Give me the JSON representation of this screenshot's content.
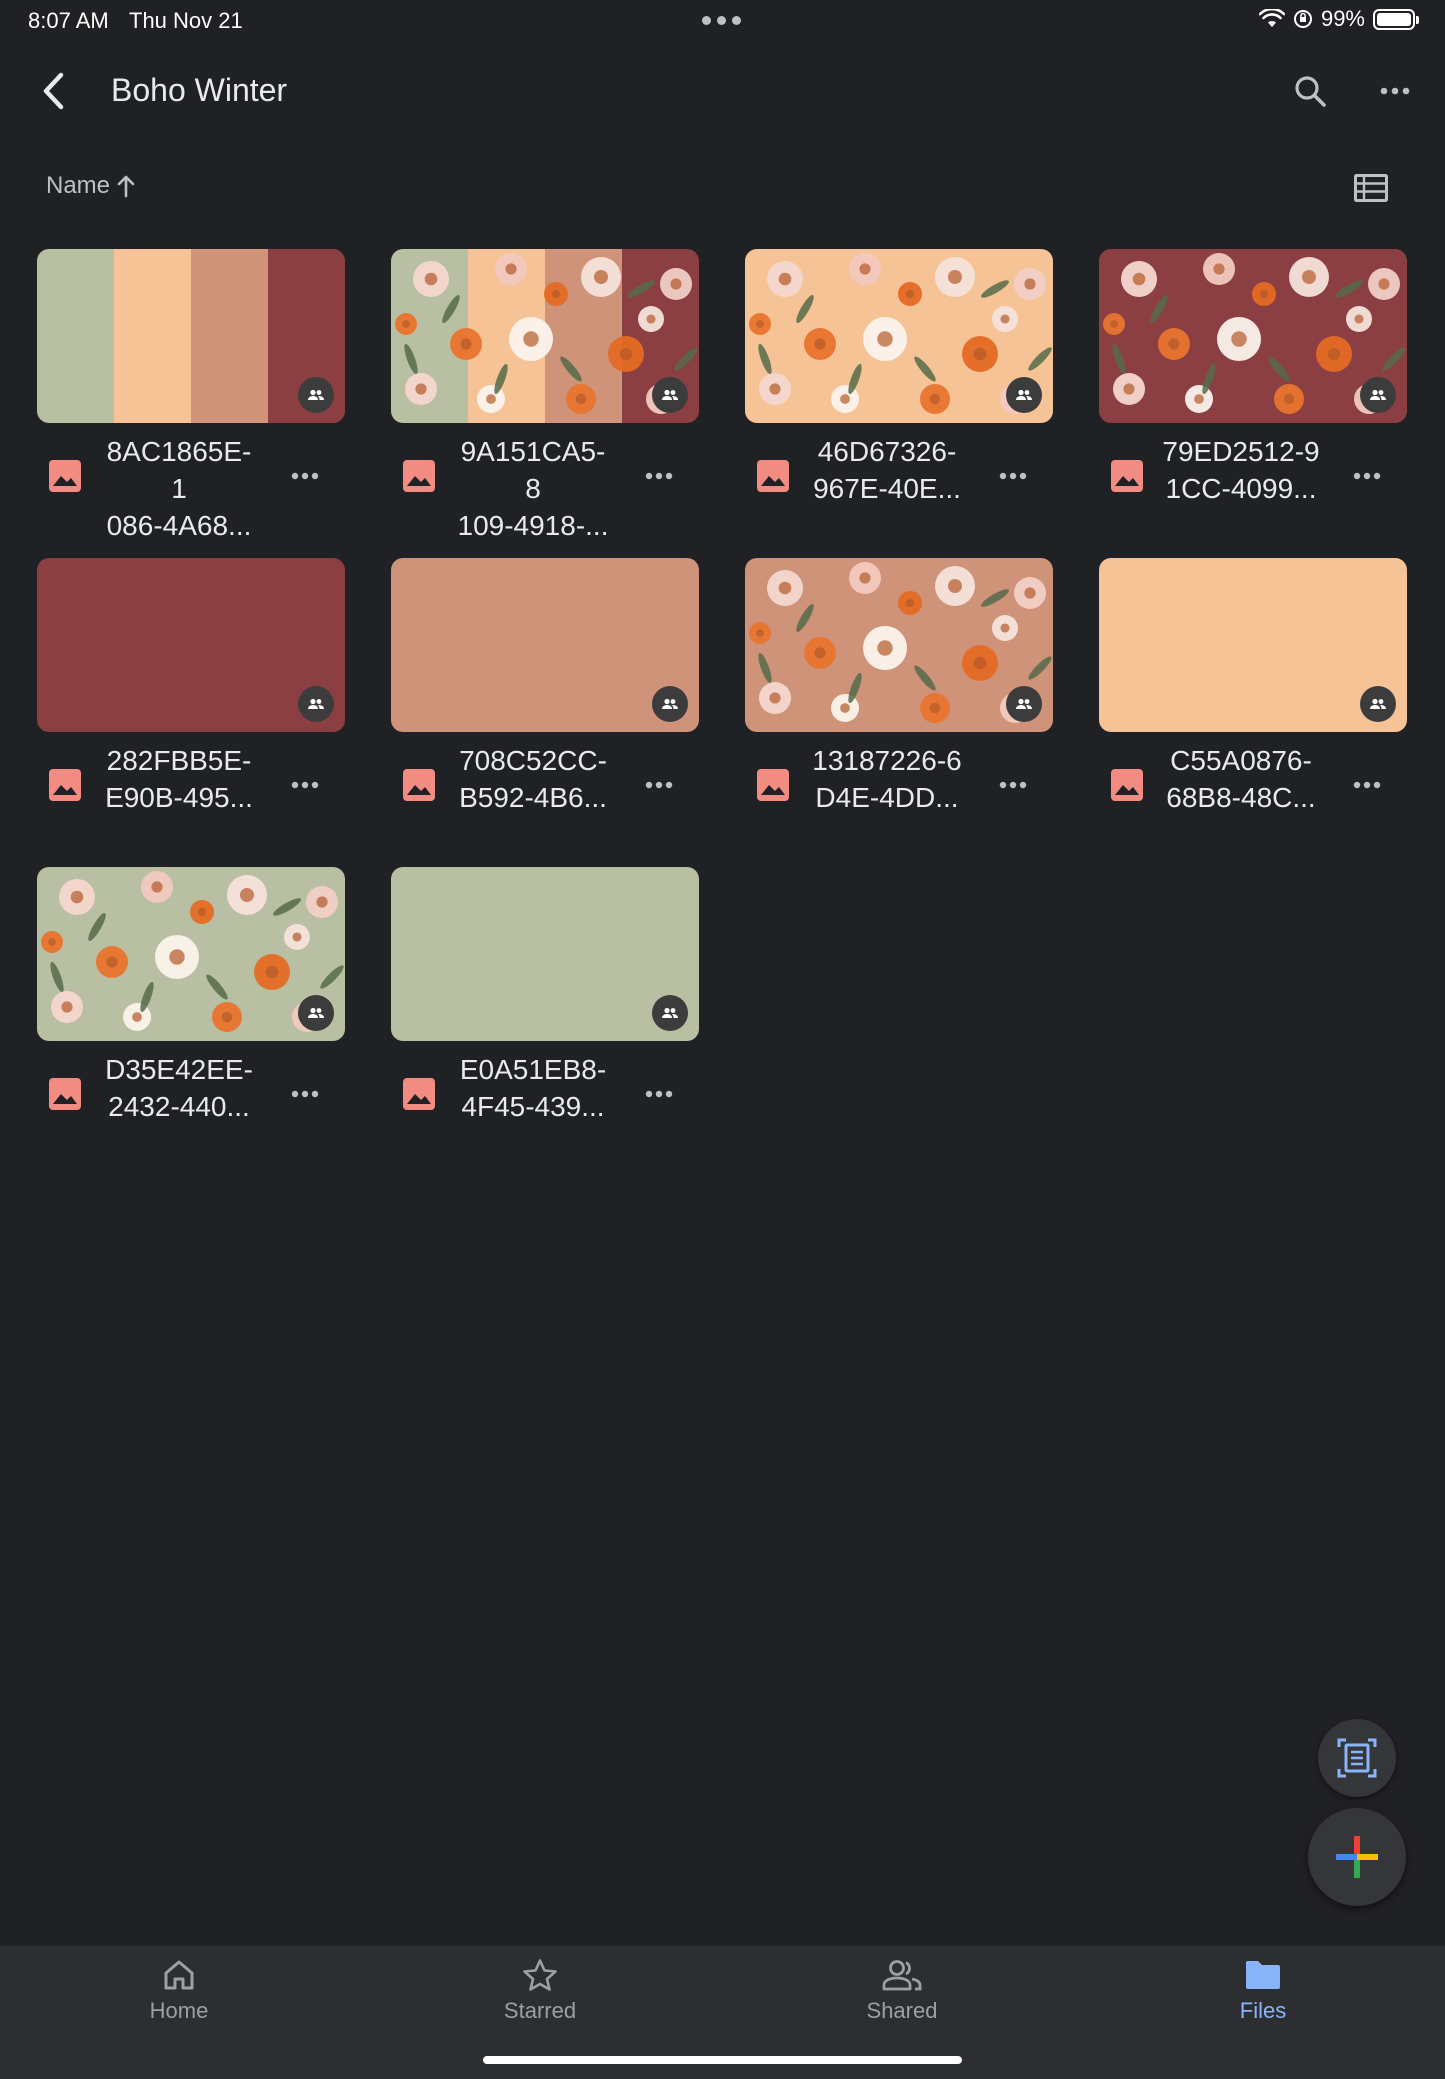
{
  "status_bar": {
    "time": "8:07 AM",
    "date": "Thu Nov 21",
    "battery": "99%"
  },
  "header": {
    "title": "Boho Winter",
    "back_icon": "chevron-left-icon",
    "search_icon": "search-icon",
    "more_icon": "more-horizontal-icon"
  },
  "sort": {
    "label": "Name",
    "direction": "ascending",
    "view_icon": "list-view-icon"
  },
  "files": [
    {
      "name_line1": "8AC1865E-1",
      "name_line2": "086-4A68...",
      "thumb": "palette",
      "shared": true
    },
    {
      "name_line1": "9A151CA5-8",
      "name_line2": "109-4918-...",
      "thumb": "floral-palette",
      "shared": true
    },
    {
      "name_line1": "46D67326-",
      "name_line2": "967E-40E...",
      "thumb": "floral-peach",
      "shared": true
    },
    {
      "name_line1": "79ED2512-9",
      "name_line2": "1CC-4099...",
      "thumb": "floral-maroon",
      "shared": true
    },
    {
      "name_line1": "282FBB5E-",
      "name_line2": "E90B-495...",
      "thumb": "solid-maroon",
      "shared": true
    },
    {
      "name_line1": "708C52CC-",
      "name_line2": "B592-4B6...",
      "thumb": "solid-terracotta",
      "shared": true
    },
    {
      "name_line1": "13187226-6",
      "name_line2": "D4E-4DD...",
      "thumb": "floral-terracotta",
      "shared": true
    },
    {
      "name_line1": "C55A0876-",
      "name_line2": "68B8-48C...",
      "thumb": "solid-peach",
      "shared": true
    },
    {
      "name_line1": "D35E42EE-",
      "name_line2": "2432-440...",
      "thumb": "floral-sage",
      "shared": true
    },
    {
      "name_line1": "E0A51EB8-",
      "name_line2": "4F45-439...",
      "thumb": "solid-sage",
      "shared": true
    }
  ],
  "colors": {
    "sage": "#b9bfa3",
    "peach": "#f6c396",
    "terracotta": "#cf9379",
    "maroon": "#8b3f42",
    "accent_blue": "#8ab4f8",
    "image_icon": "#f28b82"
  },
  "fab": {
    "scan_icon": "document-scan-icon",
    "new_icon": "plus-icon"
  },
  "bottom_nav": [
    {
      "label": "Home",
      "icon": "home-icon",
      "active": false
    },
    {
      "label": "Starred",
      "icon": "star-icon",
      "active": false
    },
    {
      "label": "Shared",
      "icon": "people-icon",
      "active": false
    },
    {
      "label": "Files",
      "icon": "folder-icon",
      "active": true
    }
  ]
}
